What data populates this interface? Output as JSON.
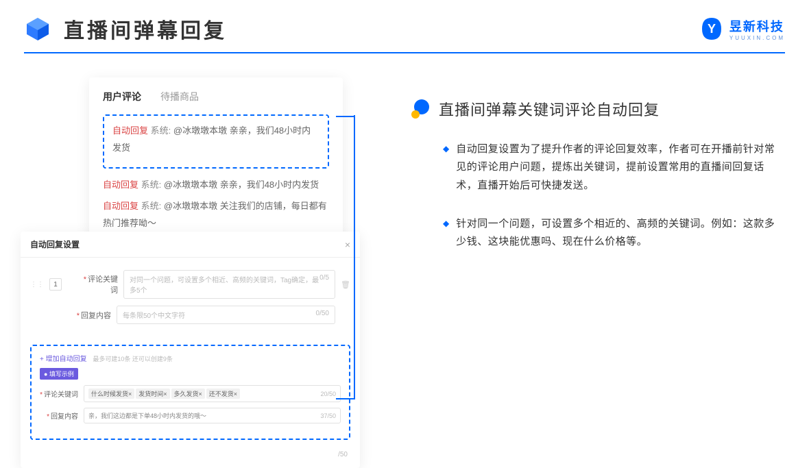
{
  "header": {
    "title": "直播间弹幕回复",
    "brand": "昱新科技",
    "brand_url": "YUUXIN.COM"
  },
  "comments_card": {
    "tab_active": "用户评论",
    "tab_inactive": "待播商品",
    "tag": "自动回复",
    "sys": "系统:",
    "highlighted": "@冰墩墩本墩 亲亲，我们48小时内发货",
    "row2": "@冰墩墩本墩 亲亲，我们48小时内发货",
    "row3": "@冰墩墩本墩 关注我们的店铺，每日都有热门推荐呦～"
  },
  "settings_card": {
    "title": "自动回复设置",
    "close": "×",
    "num": "1",
    "label_keyword": "评论关键词",
    "ph_keyword": "对同一个问题，可设置多个相近、高频的关键词，Tag确定，最多5个",
    "counter_kw": "0/5",
    "label_content": "回复内容",
    "ph_content": "每条限50个中文字符",
    "counter_ct": "0/50",
    "add_text": "+ 增加自动回复",
    "add_note": "最多可建10条 还可以创建9条",
    "badge": "● 填写示例",
    "ex_kw_label": "评论关键词",
    "ex_tags": [
      "什么时候发货×",
      "发货时间×",
      "多久发货×",
      "还不发货×"
    ],
    "ex_kw_counter": "20/50",
    "ex_ct_label": "回复内容",
    "ex_ct_value": "亲，我们这边都是下单48小时内发货的哦～",
    "ex_ct_counter": "37/50",
    "outer_counter": "/50"
  },
  "right": {
    "title": "直播间弹幕关键词评论自动回复",
    "bullets": [
      "自动回复设置为了提升作者的评论回复效率，作者可在开播前针对常见的评论用户问题，提炼出关键词，提前设置常用的直播间回复话术，直播开始后可快捷发送。",
      "针对同一个问题，可设置多个相近的、高频的关键词。例如：这款多少钱、这块能优惠吗、现在什么价格等。"
    ]
  }
}
